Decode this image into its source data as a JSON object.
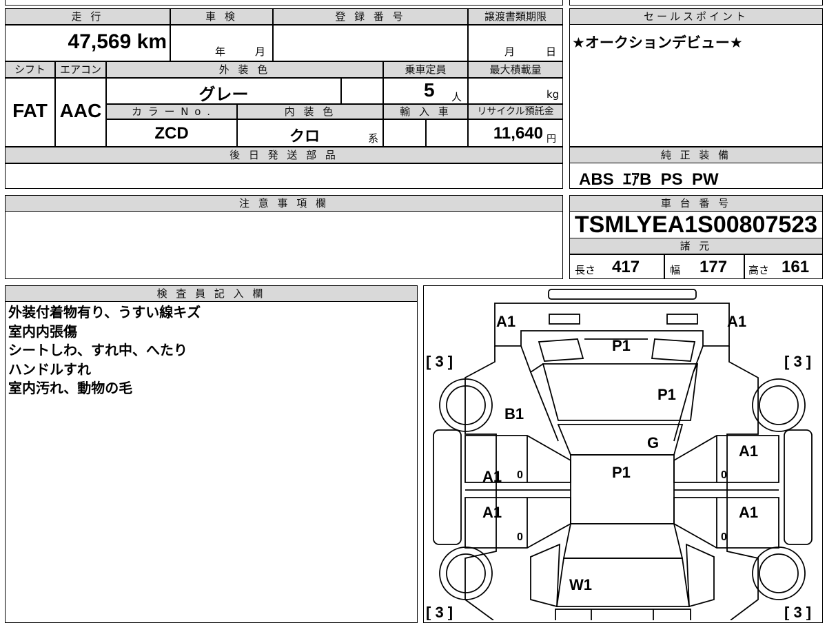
{
  "top_row": {
    "mileage_label": "走 行",
    "mileage_value": "47,569 km",
    "inspection_label": "車 検",
    "inspection_year": "年",
    "inspection_month": "月",
    "registration_label": "登 録 番 号",
    "transfer_label": "譲渡書類期限",
    "transfer_month": "月",
    "transfer_day": "日"
  },
  "second_row": {
    "shift_label": "シフト",
    "shift_value": "FAT",
    "ac_label": "エアコン",
    "ac_value": "AAC",
    "exterior_color_label": "外 装 色",
    "exterior_color_value": "グレー",
    "capacity_label": "乗車定員",
    "capacity_value": "5",
    "capacity_unit": "人",
    "max_load_label": "最大積載量",
    "max_load_unit": "kg",
    "color_no_label": "カ ラ ー N o .",
    "color_no_value": "ZCD",
    "interior_color_label": "内 装 色",
    "interior_color_value": "クロ",
    "interior_color_suffix": "系",
    "import_label": "輸 入 車",
    "recycle_label": "リサイクル預託金",
    "recycle_value": "11,640",
    "recycle_unit": "円"
  },
  "later_parts": {
    "label": "後 日 発 送 部 品"
  },
  "notes": {
    "label": "注 意 事 項 欄"
  },
  "sales_point": {
    "label": "セールスポイント",
    "text": "★オークションデビュー★"
  },
  "equipment": {
    "label": "純 正 装 備",
    "text": "ABS  ｴｱB  PS  PW"
  },
  "chassis": {
    "label": "車 台 番 号",
    "value": "TSMLYEA1S00807523"
  },
  "specs": {
    "label": "諸 元",
    "length_label": "長さ",
    "length_value": "417",
    "width_label": "幅",
    "width_value": "177",
    "height_label": "高さ",
    "height_value": "161"
  },
  "inspector": {
    "label": "検 査 員 記 入 欄",
    "lines": [
      "外装付着物有り、うすい線キズ",
      "室内内張傷",
      "シートしわ、すれ中、へたり",
      "ハンドルすれ",
      "室内汚れ、動物の毛"
    ]
  },
  "diagram": {
    "marks": {
      "a1_front_left": "A1",
      "a1_front_right": "A1",
      "p1_front": "P1",
      "tire_fl": "[ 3 ]",
      "tire_fr": "[ 3 ]",
      "tire_rl": "[ 3 ]",
      "tire_rr": "[ 3 ]",
      "p1_hood": "P1",
      "b1_left": "B1",
      "g_windshield": "G",
      "a1_right_front_door": "A1",
      "a1_left_front_door": "A1",
      "p1_roof": "P1",
      "a1_left_rear_door": "A1",
      "a1_right_rear_door": "A1",
      "w1_rear": "W1",
      "zero_lf": "0",
      "zero_lr": "0",
      "zero_rf": "0",
      "zero_rr": "0"
    }
  }
}
